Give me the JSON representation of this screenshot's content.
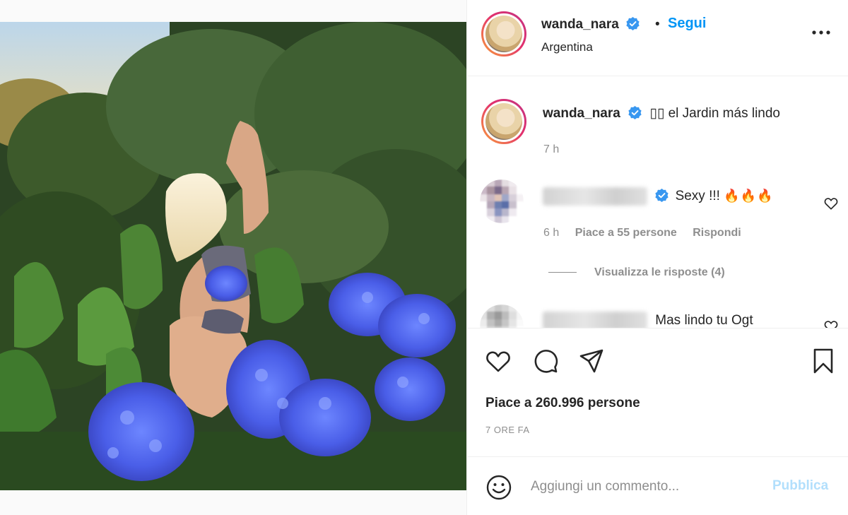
{
  "post": {
    "username": "wanda_nara",
    "location": "Argentina",
    "follow_label": "Segui",
    "separator": "•",
    "more_icon": "more-horizontal-icon"
  },
  "caption": {
    "username": "wanda_nara",
    "text": "▯▯ el Jardin más lindo",
    "time": "7 h"
  },
  "comments": [
    {
      "text": "Sexy !!!",
      "emoji": "🔥🔥🔥",
      "time": "6 h",
      "likes": "Piace a 55 persone",
      "reply_label": "Rispondi",
      "view_replies": "Visualizza le risposte (4)"
    },
    {
      "text": "Mas lindo tu Ogt"
    }
  ],
  "actions": {
    "icons": [
      "heart-icon",
      "comment-icon",
      "share-icon",
      "bookmark-icon"
    ]
  },
  "likes_text": "Piace a 260.996 persone",
  "time_ago": "7 ORE FA",
  "add_comment": {
    "placeholder": "Aggiungi un commento...",
    "publish_label": "Pubblica"
  },
  "colors": {
    "accent": "#0095f6",
    "publish_disabled": "#b2dffc",
    "muted": "#8e8e8e",
    "text": "#262626"
  }
}
